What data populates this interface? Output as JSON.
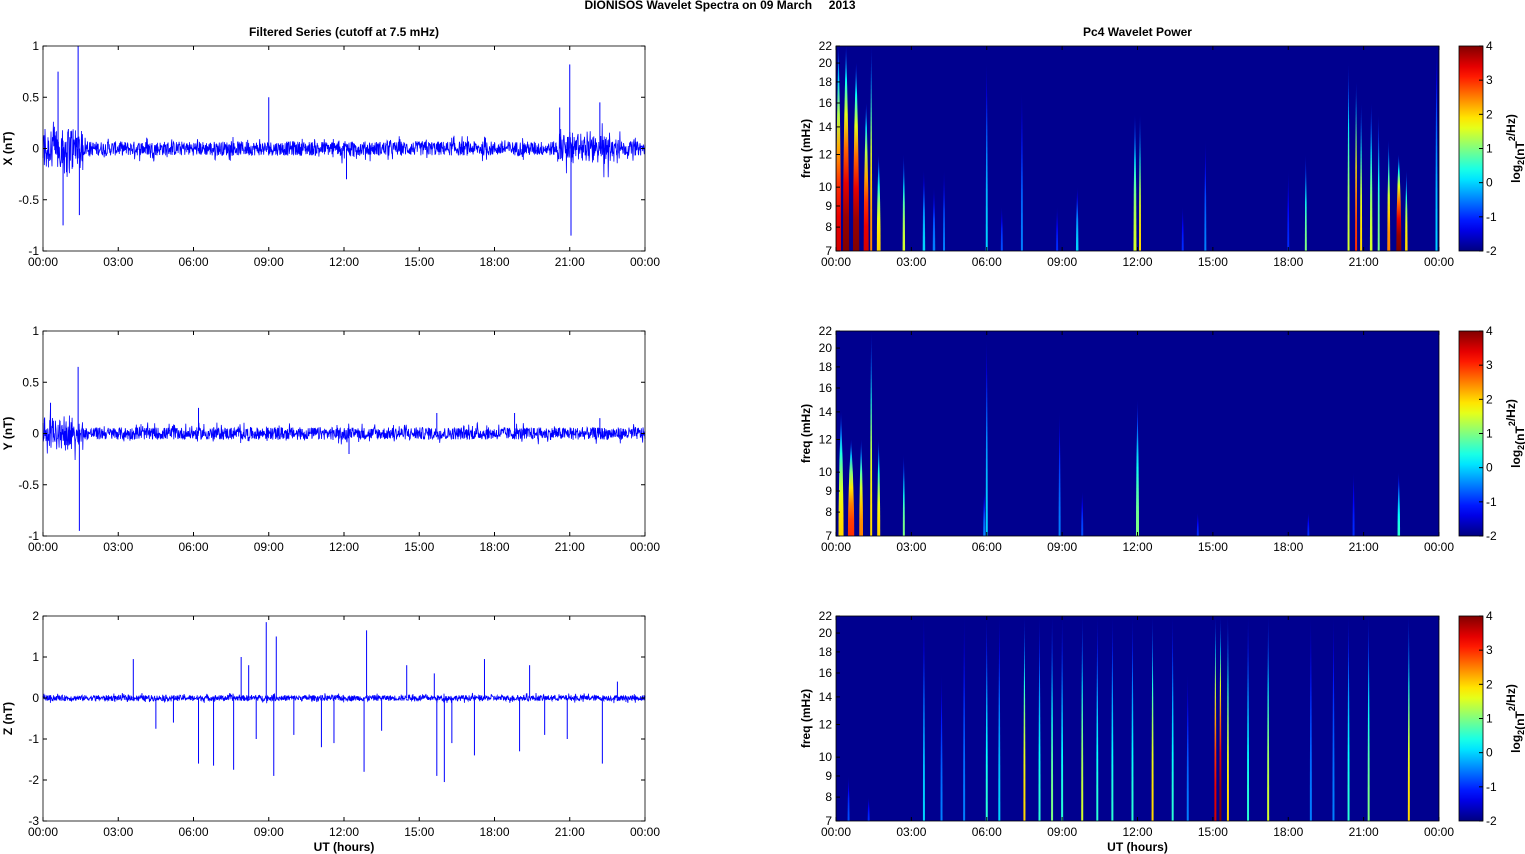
{
  "chart_data": [
    {
      "type": "line",
      "suptitle": "DIONISOS Wavelet Spectra on 09 March     2013",
      "title": "Filtered Series (cutoff at 7.5 mHz)",
      "ylabel": "X (nT)",
      "xlabel": "",
      "xlim": [
        0,
        24
      ],
      "ylim": [
        -1,
        1
      ],
      "xticks": [
        "00:00",
        "03:00",
        "06:00",
        "09:00",
        "12:00",
        "15:00",
        "18:00",
        "21:00",
        "00:00"
      ],
      "yticks": [
        -1,
        -0.5,
        0,
        0.5,
        1
      ],
      "color": "#0000ff",
      "noise_level": 0.07,
      "active_intervals": [
        [
          0,
          1.6,
          0.3
        ],
        [
          20.5,
          23,
          0.18
        ],
        [
          11.5,
          12.5,
          0.1
        ]
      ],
      "spikes": [
        [
          1.4,
          1.0
        ],
        [
          1.45,
          -0.65
        ],
        [
          0.6,
          0.75
        ],
        [
          0.8,
          -0.75
        ],
        [
          21.0,
          0.82
        ],
        [
          21.05,
          -0.85
        ],
        [
          22.2,
          0.45
        ],
        [
          9.0,
          0.5
        ],
        [
          12.1,
          -0.3
        ],
        [
          20.6,
          0.4
        ]
      ]
    },
    {
      "type": "heatmap",
      "title": "Pc4 Wavelet Power",
      "ylabel": "freq (mHz)",
      "xlim": [
        0,
        24
      ],
      "ylim": [
        7,
        22
      ],
      "yscale": "log",
      "xticks": [
        "00:00",
        "03:00",
        "06:00",
        "09:00",
        "12:00",
        "15:00",
        "18:00",
        "21:00",
        "00:00"
      ],
      "yticks": [
        7,
        8,
        9,
        10,
        12,
        14,
        16,
        18,
        20,
        22
      ],
      "colorbar": {
        "label": "log2(nT2/Hz)",
        "ticks": [
          -2,
          -1,
          0,
          1,
          2,
          3,
          4
        ],
        "range": [
          -2,
          4
        ]
      },
      "bursts": [
        [
          0.1,
          22,
          3.5,
          0.2
        ],
        [
          0.4,
          22,
          4,
          0.25
        ],
        [
          0.8,
          20,
          4,
          0.25
        ],
        [
          1.2,
          16,
          3.5,
          0.2
        ],
        [
          1.4,
          22,
          2.5,
          0.05
        ],
        [
          1.7,
          12,
          2,
          0.15
        ],
        [
          2.7,
          12,
          1.5,
          0.1
        ],
        [
          3.5,
          11,
          0,
          0.1
        ],
        [
          3.9,
          10,
          -0.5,
          0.1
        ],
        [
          4.3,
          11,
          -0.5,
          0.08
        ],
        [
          6.0,
          20,
          0,
          0.06
        ],
        [
          6.6,
          9,
          -0.8,
          0.08
        ],
        [
          7.4,
          17,
          -0.5,
          0.06
        ],
        [
          8.8,
          9,
          -1,
          0.08
        ],
        [
          9.6,
          10,
          0,
          0.1
        ],
        [
          11.9,
          15,
          1.5,
          0.12
        ],
        [
          12.1,
          15,
          2,
          0.08
        ],
        [
          14.7,
          13,
          -0.5,
          0.08
        ],
        [
          13.8,
          9,
          -1,
          0.08
        ],
        [
          18.0,
          11,
          -1,
          0.08
        ],
        [
          18.7,
          12,
          1,
          0.08
        ],
        [
          20.4,
          20,
          1.5,
          0.08
        ],
        [
          20.7,
          18,
          3,
          0.08
        ],
        [
          20.9,
          16,
          2,
          0.08
        ],
        [
          21.3,
          16,
          1.5,
          0.1
        ],
        [
          21.6,
          15,
          1,
          0.08
        ],
        [
          22.0,
          13,
          2.5,
          0.12
        ],
        [
          22.4,
          12,
          4,
          0.2
        ],
        [
          22.7,
          11,
          2,
          0.1
        ],
        [
          23.9,
          22,
          0,
          0.05
        ]
      ]
    },
    {
      "type": "line",
      "title": "",
      "ylabel": "Y (nT)",
      "xlabel": "",
      "xlim": [
        0,
        24
      ],
      "ylim": [
        -1,
        1
      ],
      "xticks": [
        "00:00",
        "03:00",
        "06:00",
        "09:00",
        "12:00",
        "15:00",
        "18:00",
        "21:00",
        "00:00"
      ],
      "yticks": [
        -1,
        -0.5,
        0,
        0.5,
        1
      ],
      "color": "#0000ff",
      "noise_level": 0.06,
      "active_intervals": [
        [
          0,
          1.6,
          0.18
        ],
        [
          11.5,
          12.5,
          0.06
        ]
      ],
      "spikes": [
        [
          1.4,
          0.65
        ],
        [
          1.45,
          -0.95
        ],
        [
          0.3,
          0.3
        ],
        [
          6.2,
          0.25
        ],
        [
          12.2,
          -0.2
        ],
        [
          15.7,
          0.2
        ],
        [
          18.8,
          0.2
        ],
        [
          22.2,
          0.15
        ]
      ]
    },
    {
      "type": "heatmap",
      "title": "",
      "ylabel": "freq (mHz)",
      "xlim": [
        0,
        24
      ],
      "ylim": [
        7,
        22
      ],
      "yscale": "log",
      "xticks": [
        "00:00",
        "03:00",
        "06:00",
        "09:00",
        "12:00",
        "15:00",
        "18:00",
        "21:00",
        "00:00"
      ],
      "yticks": [
        7,
        8,
        9,
        10,
        12,
        14,
        16,
        18,
        20,
        22
      ],
      "colorbar": {
        "label": "log2(nT2/Hz)",
        "ticks": [
          -2,
          -1,
          0,
          1,
          2,
          3,
          4
        ],
        "range": [
          -2,
          4
        ]
      },
      "bursts": [
        [
          0.2,
          14,
          2,
          0.2
        ],
        [
          0.6,
          12,
          3,
          0.25
        ],
        [
          1.0,
          12,
          2.5,
          0.15
        ],
        [
          1.4,
          22,
          2,
          0.05
        ],
        [
          1.7,
          12,
          2,
          0.12
        ],
        [
          2.7,
          11,
          1,
          0.08
        ],
        [
          6.0,
          21,
          0,
          0.06
        ],
        [
          5.9,
          9,
          -0.5,
          0.08
        ],
        [
          8.9,
          14,
          -0.5,
          0.06
        ],
        [
          9.8,
          9,
          -0.8,
          0.08
        ],
        [
          12.0,
          15,
          1,
          0.12
        ],
        [
          14.4,
          8,
          -1,
          0.06
        ],
        [
          18.8,
          8,
          -1,
          0.06
        ],
        [
          20.6,
          10,
          -1,
          0.06
        ],
        [
          22.4,
          10,
          0.5,
          0.1
        ]
      ]
    },
    {
      "type": "line",
      "title": "",
      "ylabel": "Z (nT)",
      "xlabel": "UT (hours)",
      "xlim": [
        0,
        24
      ],
      "ylim": [
        -3,
        2
      ],
      "xticks": [
        "00:00",
        "03:00",
        "06:00",
        "09:00",
        "12:00",
        "15:00",
        "18:00",
        "21:00",
        "00:00"
      ],
      "yticks": [
        -3,
        -2,
        -1,
        0,
        1,
        2
      ],
      "color": "#0000ff",
      "noise_level": 0.07,
      "active_intervals": [],
      "spikes": [
        [
          3.6,
          0.95
        ],
        [
          4.5,
          -0.75
        ],
        [
          5.2,
          -0.6
        ],
        [
          6.2,
          -1.6
        ],
        [
          6.8,
          -1.65
        ],
        [
          7.6,
          -1.75
        ],
        [
          7.9,
          1.0
        ],
        [
          8.2,
          0.8
        ],
        [
          8.5,
          -1.0
        ],
        [
          8.9,
          1.85
        ],
        [
          9.3,
          1.5
        ],
        [
          9.2,
          -1.9
        ],
        [
          10.0,
          -0.9
        ],
        [
          11.1,
          -1.2
        ],
        [
          11.6,
          -1.1
        ],
        [
          12.8,
          -1.8
        ],
        [
          12.9,
          1.65
        ],
        [
          13.5,
          -0.8
        ],
        [
          14.5,
          0.8
        ],
        [
          15.6,
          0.6
        ],
        [
          15.7,
          -1.9
        ],
        [
          16.0,
          -2.05
        ],
        [
          16.3,
          -1.1
        ],
        [
          17.2,
          -1.4
        ],
        [
          17.6,
          0.95
        ],
        [
          19.0,
          -1.3
        ],
        [
          19.4,
          0.8
        ],
        [
          20.0,
          -0.9
        ],
        [
          20.9,
          -1.0
        ],
        [
          22.3,
          -1.6
        ],
        [
          22.9,
          0.4
        ]
      ]
    },
    {
      "type": "heatmap",
      "title": "",
      "ylabel": "freq (mHz)",
      "xlabel": "UT (hours)",
      "xlim": [
        0,
        24
      ],
      "ylim": [
        7,
        22
      ],
      "yscale": "log",
      "xticks": [
        "00:00",
        "03:00",
        "06:00",
        "09:00",
        "12:00",
        "15:00",
        "18:00",
        "21:00",
        "00:00"
      ],
      "yticks": [
        7,
        8,
        9,
        10,
        12,
        14,
        16,
        18,
        20,
        22
      ],
      "colorbar": {
        "label": "log2(nT2/Hz)",
        "ticks": [
          -2,
          -1,
          0,
          1,
          2,
          3,
          4
        ],
        "range": [
          -2,
          4
        ]
      },
      "bursts": [
        [
          0.5,
          9,
          -0.8,
          0.05
        ],
        [
          1.3,
          8,
          -1,
          0.05
        ],
        [
          3.5,
          22,
          0,
          0.04
        ],
        [
          4.2,
          16,
          -0.5,
          0.04
        ],
        [
          5.1,
          22,
          -0.5,
          0.04
        ],
        [
          6.0,
          22,
          0.5,
          0.04
        ],
        [
          6.5,
          22,
          0,
          0.04
        ],
        [
          7.5,
          22,
          2,
          0.05
        ],
        [
          8.1,
          22,
          0.5,
          0.04
        ],
        [
          8.6,
          22,
          1,
          0.04
        ],
        [
          9.0,
          22,
          0.5,
          0.04
        ],
        [
          9.8,
          22,
          1.5,
          0.05
        ],
        [
          10.4,
          22,
          0.5,
          0.04
        ],
        [
          11.0,
          22,
          0.5,
          0.04
        ],
        [
          11.8,
          22,
          0.5,
          0.04
        ],
        [
          12.6,
          22,
          2,
          0.05
        ],
        [
          13.4,
          22,
          0.5,
          0.04
        ],
        [
          14.0,
          16,
          -0.5,
          0.04
        ],
        [
          15.1,
          22,
          3.5,
          0.05
        ],
        [
          15.3,
          22,
          4,
          0.05
        ],
        [
          15.6,
          22,
          2,
          0.04
        ],
        [
          16.4,
          22,
          0.5,
          0.04
        ],
        [
          17.2,
          22,
          1.5,
          0.05
        ],
        [
          18.9,
          22,
          -0.5,
          0.04
        ],
        [
          19.8,
          22,
          -0.5,
          0.04
        ],
        [
          20.4,
          22,
          0.5,
          0.04
        ],
        [
          21.2,
          22,
          1,
          0.04
        ],
        [
          22.8,
          22,
          2,
          0.05
        ]
      ]
    }
  ]
}
